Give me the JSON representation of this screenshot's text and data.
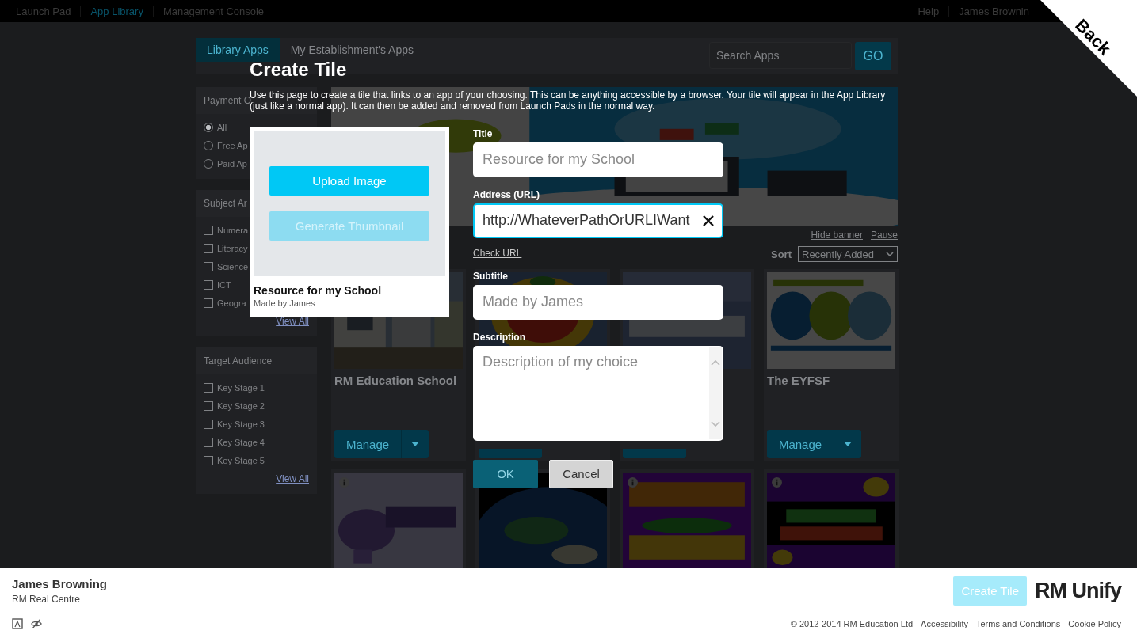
{
  "top_nav": {
    "items": [
      {
        "label": "Launch Pad",
        "selected": false
      },
      {
        "label": "App Library",
        "selected": true
      },
      {
        "label": "Management Console",
        "selected": false
      }
    ],
    "right_items": [
      "Help",
      "James Brownin"
    ]
  },
  "back_link": "Back",
  "library": {
    "tabs": [
      {
        "label": "Library Apps",
        "selected": true
      },
      {
        "label": "My Establishment's Apps",
        "selected": false
      }
    ],
    "search": {
      "placeholder": "Search Apps",
      "button": "GO"
    },
    "filters": [
      {
        "title": "Payment O",
        "kind": "radio",
        "options": [
          {
            "label": "All",
            "selected": true
          },
          {
            "label": "Free Ap",
            "selected": false
          },
          {
            "label": "Paid Ap",
            "selected": false
          }
        ]
      },
      {
        "title": "Subject Ar",
        "kind": "checkbox",
        "options": [
          {
            "label": "Numera",
            "checked": false
          },
          {
            "label": "Literacy",
            "checked": false
          },
          {
            "label": "Science",
            "checked": false
          },
          {
            "label": "ICT",
            "checked": false
          },
          {
            "label": "Geogra",
            "checked": false
          }
        ],
        "link": "View All"
      },
      {
        "title": "Target Audience",
        "kind": "checkbox",
        "options": [
          {
            "label": "Key Stage 1",
            "checked": false
          },
          {
            "label": "Key Stage 2",
            "checked": false
          },
          {
            "label": "Key Stage 3",
            "checked": false
          },
          {
            "label": "Key Stage 4",
            "checked": false
          },
          {
            "label": "Key Stage 5",
            "checked": false
          }
        ],
        "link": "View All"
      }
    ],
    "banner": {
      "kind": "picture",
      "links": [
        "Hide banner",
        "Pause"
      ]
    },
    "sort": {
      "label": "Sort",
      "value": "Recently Added"
    },
    "tiles": [
      {
        "kind": "app",
        "title": "RM Education School",
        "button": "Manage"
      },
      {
        "kind": "app"
      },
      {
        "kind": "app"
      },
      {
        "kind": "app",
        "title": "The EYFSF",
        "button": "Manage"
      },
      {
        "kind": "preview"
      },
      {
        "kind": "picture"
      },
      {
        "kind": "preview"
      },
      {
        "kind": "preview"
      }
    ]
  },
  "dialog": {
    "title": "Create Tile",
    "description": "Use this page to create a tile that links to an app of your choosing. This can be anything accessible by a browser. Your tile will appear in the App Library (just like a normal app). It can then be added and removed from Launch Pads in the normal way.",
    "preview": {
      "upload_button": "Upload Image",
      "thumbnail_button": {
        "label": "Generate Thumbnail",
        "disabled": true
      },
      "title": "Resource for my School",
      "subtitle": "Made by James"
    },
    "fields": [
      {
        "kind": "text",
        "label": "Title",
        "placeholder": "Resource for my School",
        "focused": false
      },
      {
        "kind": "text",
        "label": "Address (URL)",
        "value": "http://WhateverPathOrURLIWant",
        "focused": true,
        "link": "Check URL"
      },
      {
        "kind": "text",
        "label": "Subtitle",
        "placeholder": "Made by James",
        "focused": false
      },
      {
        "kind": "textarea",
        "label": "Description",
        "placeholder": "Description of my choice",
        "focused": false
      }
    ],
    "buttons": [
      {
        "label": "OK",
        "disabled": true
      },
      {
        "label": "Cancel",
        "disabled": false
      }
    ]
  },
  "footer": {
    "user_name": "James Browning",
    "organisation": "RM Real Centre",
    "create_button": {
      "label": "Create Tile",
      "disabled": true
    },
    "logo": "RM Unify",
    "copyright": "© 2012-2014 RM Education Ltd",
    "links": [
      "Accessibility",
      "Terms and Conditions",
      "Cookie Policy"
    ]
  }
}
